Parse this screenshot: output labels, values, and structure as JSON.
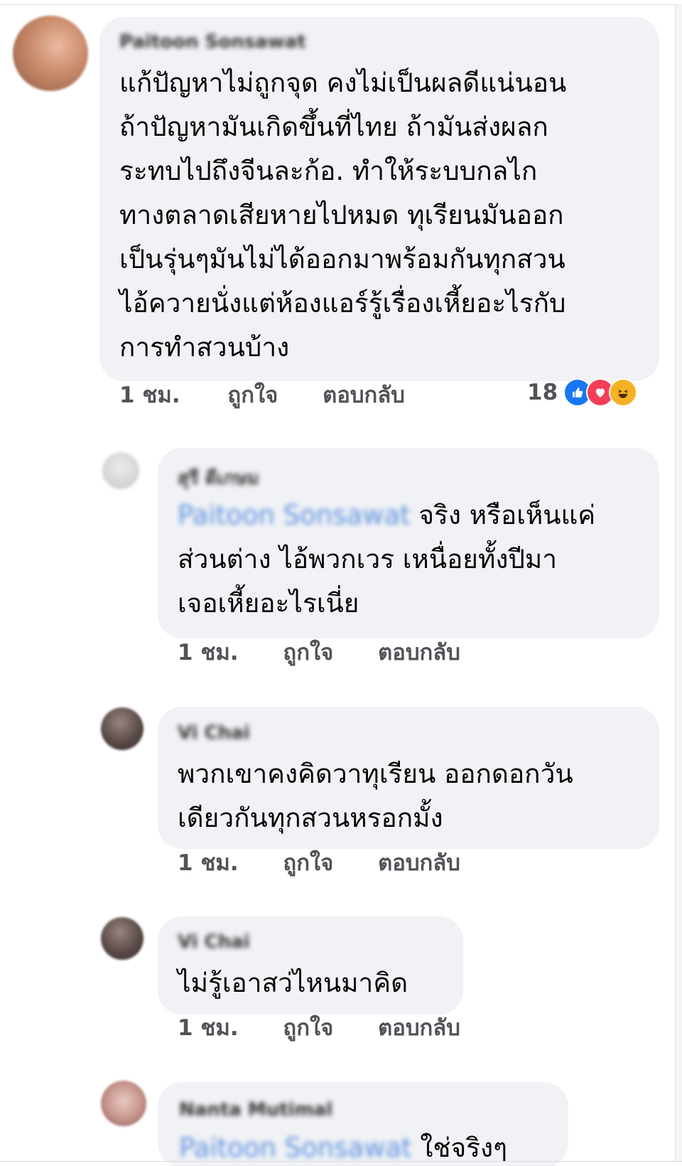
{
  "comments": [
    {
      "author": "Paitoon Sonsawat",
      "text": "แก้ปัญหาไม่ถูกจุด คงไม่เป็นผลดีแน่นอน\nถ้าปัญหามันเกิดขึ้นที่ไทย ถ้ามันส่งผลก\nระทบไปถึงจีนละก้อ. ทำให้ระบบกลไก\nทางตลาดเสียหายไปหมด ทุเรียนมันออก\nเป็นรุ่นๆมันไม่ได้ออกมาพร้อมกันทุกสวน\nไอ้ควายนั่งแต่ห้องแอร์รู้เรื่องเหี้ยอะไรกับ\nการทำสวนบ้าง",
      "time": "1 ชม.",
      "like_label": "ถูกใจ",
      "reply_label": "ตอบกลับ",
      "reaction_count": "18",
      "reactions": [
        "like-icon",
        "love-icon",
        "haha-icon"
      ]
    },
    {
      "author": "สุรี ดีเกษม",
      "mention": "Paitoon Sonsawat",
      "text_after_mention": " จริง หรือเห็นแค่",
      "text": "ส่วนต่าง ไอ้พวกเวร เหนื่อยทั้งปีมา\nเจอเหี้ยอะไรเนี่ย",
      "time": "1 ชม.",
      "like_label": "ถูกใจ",
      "reply_label": "ตอบกลับ"
    },
    {
      "author": "Vi Chai",
      "text": "พวกเขาคงคิดวาทุเรียน ออกดอกวัน\nเดียวกันทุกสวนหรอกมั้ง",
      "time": "1 ชม.",
      "like_label": "ถูกใจ",
      "reply_label": "ตอบกลับ"
    },
    {
      "author": "Vi Chai",
      "text": "ไม่รู้เอาสว่ไหนมาคิด",
      "time": "1 ชม.",
      "like_label": "ถูกใจ",
      "reply_label": "ตอบกลับ"
    },
    {
      "author": "Nanta Mutimal",
      "mention": "Paitoon Sonsawat",
      "text_after_mention": " ใช่จริงๆ"
    }
  ],
  "colors": {
    "bubble": "#f0f2f5",
    "mention": "#5b8fe0",
    "action_text": "#505357",
    "like": "#1877f2",
    "love": "#f33e58",
    "haha": "#f7b125"
  }
}
